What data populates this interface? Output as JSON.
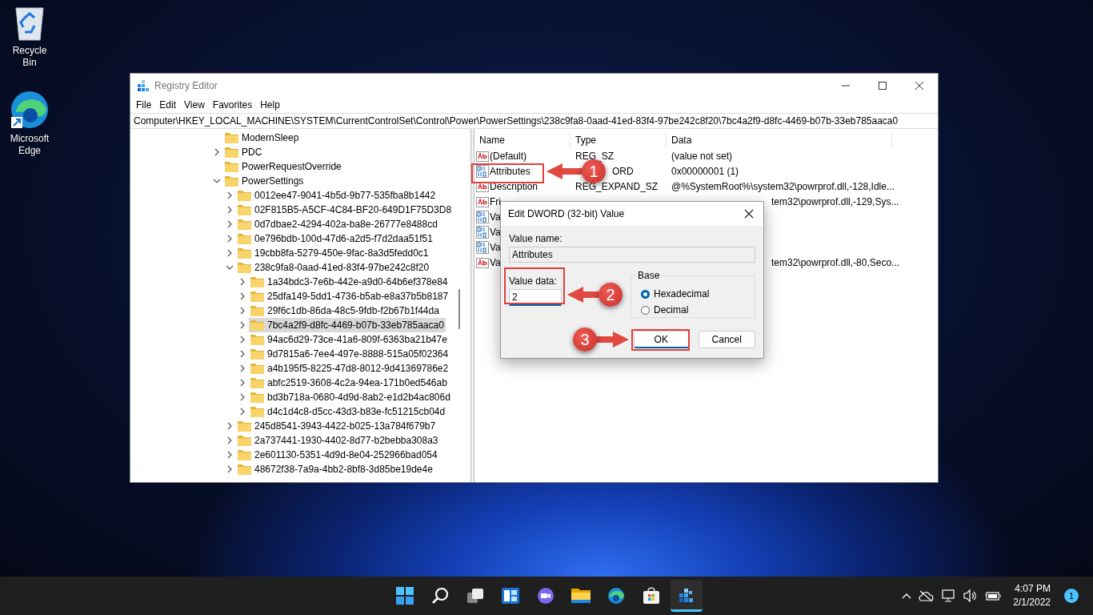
{
  "desktop_icons": [
    {
      "label": "Recycle Bin",
      "kind": "recycle"
    },
    {
      "label": "Microsoft Edge",
      "kind": "edge"
    }
  ],
  "registry_editor": {
    "title": "Registry Editor",
    "menu": [
      "File",
      "Edit",
      "View",
      "Favorites",
      "Help"
    ],
    "address": "Computer\\HKEY_LOCAL_MACHINE\\SYSTEM\\CurrentControlSet\\Control\\Power\\PowerSettings\\238c9fa8-0aad-41ed-83f4-97be242c8f20\\7bc4a2f9-d8fc-4469-b07b-33eb785aaca0",
    "tree": [
      {
        "label": "ModernSleep",
        "kind": "leaf",
        "selected": false
      },
      {
        "label": "PDC",
        "kind": "node",
        "expanded": false,
        "selected": false
      },
      {
        "label": "PowerRequestOverride",
        "kind": "leaf",
        "selected": false
      },
      {
        "label": "PowerSettings",
        "kind": "node",
        "expanded": true,
        "selected": false,
        "children": [
          {
            "label": "0012ee47-9041-4b5d-9b77-535fba8b1442",
            "kind": "node",
            "expanded": false,
            "selected": false
          },
          {
            "label": "02F815B5-A5CF-4C84-BF20-649D1F75D3D8",
            "kind": "node",
            "expanded": false,
            "selected": false
          },
          {
            "label": "0d7dbae2-4294-402a-ba8e-26777e8488cd",
            "kind": "node",
            "expanded": false,
            "selected": false
          },
          {
            "label": "0e796bdb-100d-47d6-a2d5-f7d2daa51f51",
            "kind": "node",
            "expanded": false,
            "selected": false
          },
          {
            "label": "19cbb8fa-5279-450e-9fac-8a3d5fedd0c1",
            "kind": "node",
            "expanded": false,
            "selected": false
          },
          {
            "label": "238c9fa8-0aad-41ed-83f4-97be242c8f20",
            "kind": "node",
            "expanded": true,
            "selected": false,
            "children": [
              {
                "label": "1a34bdc3-7e6b-442e-a9d0-64b6ef378e84",
                "kind": "node",
                "expanded": false,
                "selected": false
              },
              {
                "label": "25dfa149-5dd1-4736-b5ab-e8a37b5b8187",
                "kind": "node",
                "expanded": false,
                "selected": false
              },
              {
                "label": "29f6c1db-86da-48c5-9fdb-f2b67b1f44da",
                "kind": "node",
                "expanded": false,
                "selected": false
              },
              {
                "label": "7bc4a2f9-d8fc-4469-b07b-33eb785aaca0",
                "kind": "node",
                "expanded": false,
                "selected": true
              },
              {
                "label": "94ac6d29-73ce-41a6-809f-6363ba21b47e",
                "kind": "node",
                "expanded": false,
                "selected": false
              },
              {
                "label": "9d7815a6-7ee4-497e-8888-515a05f02364",
                "kind": "node",
                "expanded": false,
                "selected": false
              },
              {
                "label": "a4b195f5-8225-47d8-8012-9d41369786e2",
                "kind": "node",
                "expanded": false,
                "selected": false
              },
              {
                "label": "abfc2519-3608-4c2a-94ea-171b0ed546ab",
                "kind": "node",
                "expanded": false,
                "selected": false
              },
              {
                "label": "bd3b718a-0680-4d9d-8ab2-e1d2b4ac806d",
                "kind": "node",
                "expanded": false,
                "selected": false
              },
              {
                "label": "d4c1d4c8-d5cc-43d3-b83e-fc51215cb04d",
                "kind": "node",
                "expanded": false,
                "selected": false
              }
            ]
          },
          {
            "label": "245d8541-3943-4422-b025-13a784f679b7",
            "kind": "node",
            "expanded": false,
            "selected": false
          },
          {
            "label": "2a737441-1930-4402-8d77-b2bebba308a3",
            "kind": "node",
            "expanded": false,
            "selected": false
          },
          {
            "label": "2e601130-5351-4d9d-8e04-252966bad054",
            "kind": "node",
            "expanded": false,
            "selected": false
          },
          {
            "label": "48672f38-7a9a-4bb2-8bf8-3d85be19de4e",
            "kind": "node",
            "expanded": false,
            "selected": false
          }
        ]
      }
    ],
    "columns": [
      "Name",
      "Type",
      "Data"
    ],
    "values": [
      {
        "name": "(Default)",
        "type": "REG_SZ",
        "data": "(value not set)",
        "kind": "string"
      },
      {
        "name": "Attributes",
        "type": "ORD",
        "data": "0x00000001 (1)",
        "kind": "binary"
      },
      {
        "name": "Description",
        "type": "REG_EXPAND_SZ",
        "data": "@%SystemRoot%\\system32\\powrprof.dll,-128,Idle...",
        "kind": "string"
      },
      {
        "name": "Fri",
        "data": "tem32\\powrprof.dll,-129,Sys...",
        "kind": "string"
      },
      {
        "name": "Va",
        "kind": "binary"
      },
      {
        "name": "Va",
        "kind": "binary"
      },
      {
        "name": "Va",
        "kind": "binary"
      },
      {
        "name": "Va",
        "data": "tem32\\powrprof.dll,-80,Seco...",
        "kind": "string"
      }
    ]
  },
  "dialog": {
    "title": "Edit DWORD (32-bit) Value",
    "value_name_label": "Value name:",
    "value_name": "Attributes",
    "value_data_label": "Value data:",
    "value_data": "2",
    "base_label": "Base",
    "base_options": [
      {
        "label": "Hexadecimal",
        "selected": true
      },
      {
        "label": "Decimal",
        "selected": false
      }
    ],
    "buttons": [
      {
        "label": "OK",
        "kind": "default"
      },
      {
        "label": "Cancel",
        "kind": "normal"
      }
    ]
  },
  "annotations": [
    {
      "number": "1"
    },
    {
      "number": "2"
    },
    {
      "number": "3"
    }
  ],
  "taskbar": {
    "apps": [
      {
        "kind": "start",
        "selected": false
      },
      {
        "kind": "search",
        "selected": false
      },
      {
        "kind": "taskview",
        "selected": false
      },
      {
        "kind": "widgets",
        "selected": false
      },
      {
        "kind": "chat",
        "selected": false
      },
      {
        "kind": "explorer",
        "selected": false
      },
      {
        "kind": "edge",
        "selected": false
      },
      {
        "kind": "store",
        "selected": false
      },
      {
        "kind": "regedit",
        "selected": true
      }
    ],
    "time": "4:07 PM",
    "date": "2/1/2022",
    "notification_count": "1"
  }
}
